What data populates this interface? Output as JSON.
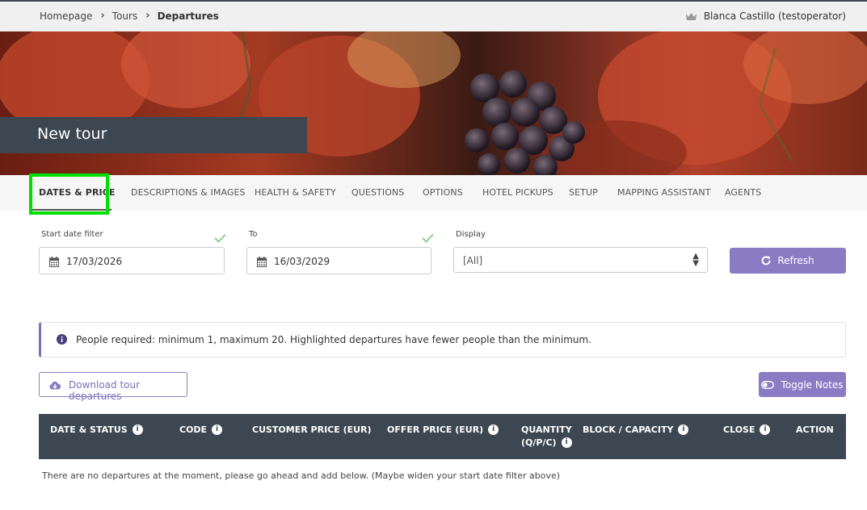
{
  "breadcrumb": {
    "items": [
      "Homepage",
      "Tours"
    ],
    "current": "Departures"
  },
  "user": {
    "name": "Blanca Castillo",
    "username": "(testoperator)",
    "icon": "crown-icon"
  },
  "hero": {
    "title": "New tour"
  },
  "tabs": [
    "DATES & PRICE",
    "DESCRIPTIONS & IMAGES",
    "HEALTH & SAFETY",
    "QUESTIONS",
    "OPTIONS",
    "HOTEL PICKUPS",
    "SETUP",
    "MAPPING ASSISTANT",
    "AGENTS"
  ],
  "filters": {
    "start_label": "Start date filter",
    "start_value": "17/03/2026",
    "to_label": "To",
    "to_value": "16/03/2029",
    "display_label": "Display",
    "display_value": "[All]",
    "refresh_label": "Refresh"
  },
  "alert": {
    "text": "People required: minimum 1, maximum 20. Highlighted departures have fewer people than the minimum."
  },
  "actions": {
    "download_label": "Download tour departures",
    "toggle_notes_label": "Toggle Notes"
  },
  "table": {
    "columns": [
      "DATE & STATUS",
      "CODE",
      "CUSTOMER PRICE (EUR)",
      "OFFER PRICE (EUR)",
      "QUANTITY",
      "(Q/P/C)",
      "BLOCK / CAPACITY",
      "CLOSE",
      "ACTION"
    ],
    "empty_message": "There are no departures at the moment, please go ahead and add below. (Maybe widen your start date filter above)"
  },
  "colors": {
    "accent": "#8a7cc4",
    "dark": "#3d4752",
    "highlight": "#00e000",
    "check": "#8fce8f"
  }
}
